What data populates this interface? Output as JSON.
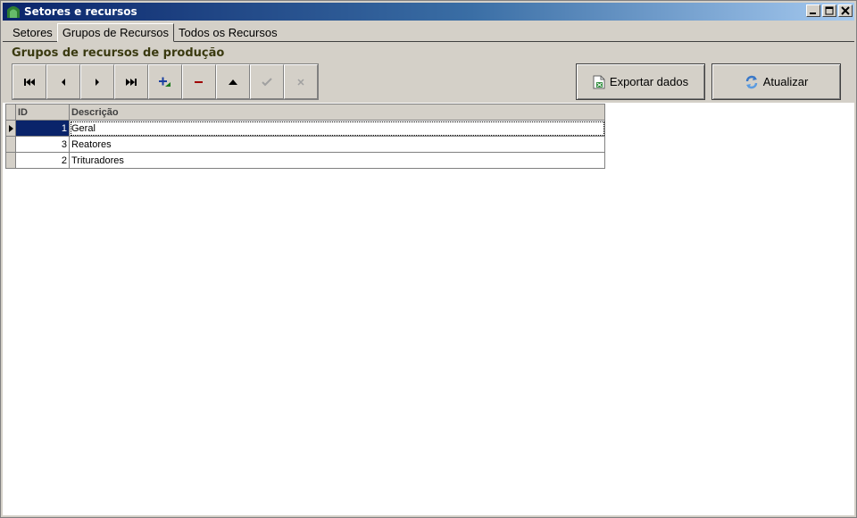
{
  "window": {
    "title": "Setores e recursos",
    "icon": "app-icon",
    "controls": [
      "minimize-icon",
      "maximize-icon",
      "close-icon"
    ]
  },
  "tabs": [
    {
      "label": "Setores",
      "active": false
    },
    {
      "label": "Grupos de Recursos",
      "active": true
    },
    {
      "label": "Todos os Recursos",
      "active": false
    }
  ],
  "section": {
    "title": "Grupos de recursos de produção"
  },
  "navigator": {
    "buttons": [
      "first-icon",
      "prior-icon",
      "next-icon",
      "last-icon",
      "insert-icon",
      "delete-icon",
      "edit-icon",
      "post-icon",
      "cancel-icon"
    ]
  },
  "actions": {
    "export_label": "Exportar dados",
    "refresh_label": "Atualizar"
  },
  "grid": {
    "columns": [
      "ID",
      "Descrição"
    ],
    "rows": [
      {
        "id": "1",
        "descricao": "Geral",
        "selected": true
      },
      {
        "id": "3",
        "descricao": "Reatores",
        "selected": false
      },
      {
        "id": "2",
        "descricao": "Trituradores",
        "selected": false
      }
    ]
  },
  "colors": {
    "titlebar_start": "#0a246a",
    "titlebar_end": "#a6caf0",
    "selection": "#0a246a",
    "section_title": "#3a3a10",
    "delete_icon": "#a00000",
    "insert_icon": "#1a7a1a"
  }
}
